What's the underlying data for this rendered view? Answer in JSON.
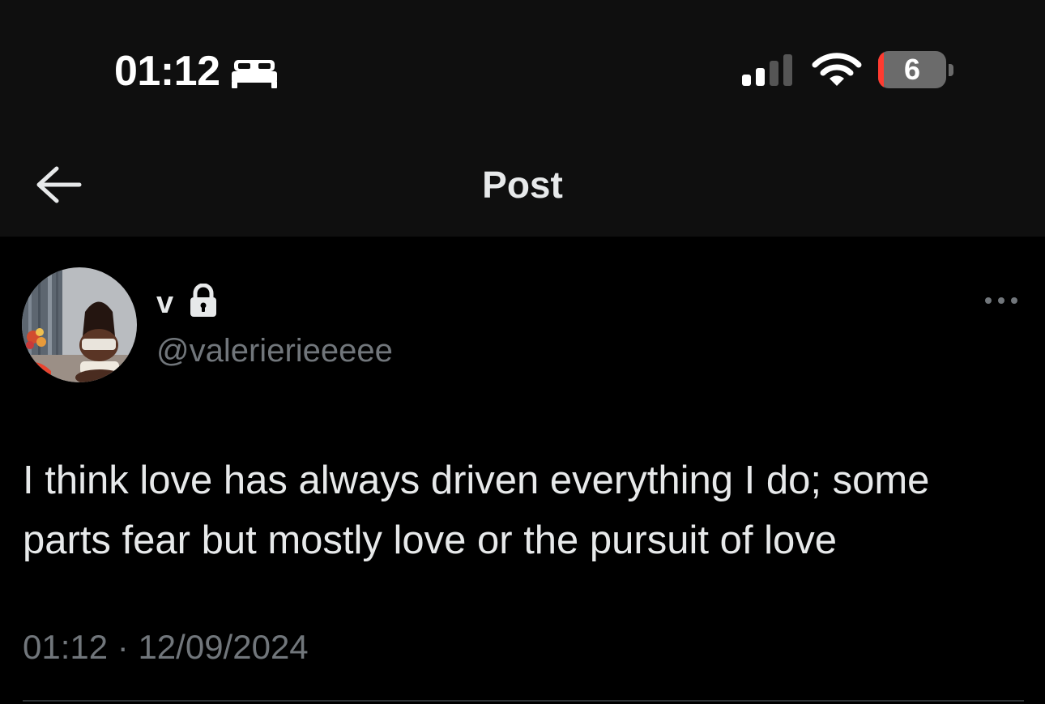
{
  "status_bar": {
    "time": "01:12",
    "sleep_icon": "bed-icon",
    "signal_icon": "cellular-signal-icon",
    "wifi_icon": "wifi-icon",
    "battery_level": "6",
    "battery_color": "#ff3b30"
  },
  "header": {
    "back_icon": "arrow-left-icon",
    "title": "Post"
  },
  "post": {
    "author": {
      "display_name": "v",
      "locked_icon": "lock-icon",
      "handle": "@valerierieeeee"
    },
    "more_icon": "more-horizontal-icon",
    "text": "I think love has always driven everything I do; some parts fear but mostly love or the pursuit of love",
    "time": "01:12",
    "separator": "·",
    "date": "12/09/2024"
  },
  "colors": {
    "background": "#000000",
    "header_background": "#0f0f0f",
    "primary_text": "#e7e9ea",
    "secondary_text": "#71767b",
    "divider": "#2f3336"
  }
}
